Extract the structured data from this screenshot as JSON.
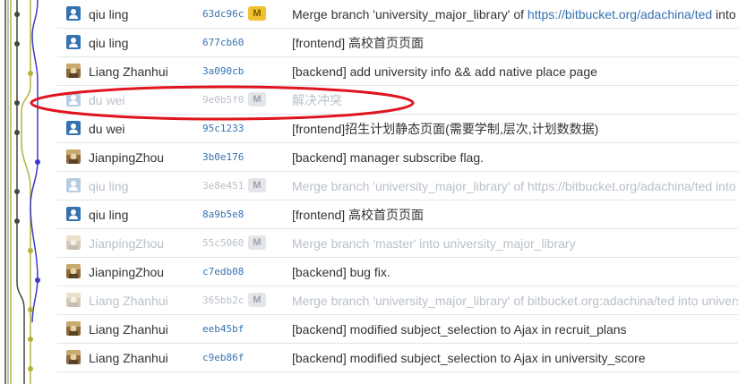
{
  "commits": [
    {
      "author": "qiu ling",
      "avatar": "blue-user-icon",
      "hash": "63dc96c",
      "merge": true,
      "merge_label": "M",
      "message": "Merge branch 'university_major_library' of ",
      "link": "https://bitbucket.org/adachina/ted",
      "message_tail": " into university_major_library",
      "faded": false
    },
    {
      "author": "qiu ling",
      "avatar": "blue-user-icon",
      "hash": "677cb60",
      "merge": false,
      "merge_label": "",
      "message": "[frontend] 高校首页页面",
      "link": "",
      "message_tail": "",
      "faded": false
    },
    {
      "author": "Liang Zhanhui",
      "avatar": "photo-avatar-icon",
      "hash": "3a090cb",
      "merge": false,
      "merge_label": "",
      "message": "[backend] add university info && add native place page",
      "link": "",
      "message_tail": "",
      "faded": false
    },
    {
      "author": "du wei",
      "avatar": "blue-user-icon",
      "hash": "9e0b5f0",
      "merge": true,
      "merge_label": "M",
      "message": "解决冲突",
      "link": "",
      "message_tail": "",
      "faded": true
    },
    {
      "author": "du wei",
      "avatar": "blue-user-icon",
      "hash": "95c1233",
      "merge": false,
      "merge_label": "",
      "message": "[frontend]招生计划静态页面(需要学制,层次,计划数数据)",
      "link": "",
      "message_tail": "",
      "faded": false
    },
    {
      "author": "JianpingZhou",
      "avatar": "photo-avatar-icon",
      "hash": "3b0e176",
      "merge": false,
      "merge_label": "",
      "message": "[backend] manager subscribe flag.",
      "link": "",
      "message_tail": "",
      "faded": false
    },
    {
      "author": "qiu ling",
      "avatar": "blue-user-icon",
      "hash": "3e8e451",
      "merge": true,
      "merge_label": "M",
      "message": "Merge branch 'university_major_library' of ",
      "link": "https://bitbucket.org/adachina/ted",
      "message_tail": " into university_major_library",
      "faded": true
    },
    {
      "author": "qiu ling",
      "avatar": "blue-user-icon",
      "hash": "8a9b5e8",
      "merge": false,
      "merge_label": "",
      "message": "[frontend] 高校首页页面",
      "link": "",
      "message_tail": "",
      "faded": false
    },
    {
      "author": "JianpingZhou",
      "avatar": "photo-avatar-icon",
      "hash": "55c5060",
      "merge": true,
      "merge_label": "M",
      "message": "Merge branch 'master' into university_major_library",
      "link": "",
      "message_tail": "",
      "faded": true
    },
    {
      "author": "JianpingZhou",
      "avatar": "photo-avatar-icon",
      "hash": "c7edb08",
      "merge": false,
      "merge_label": "",
      "message": "[backend] bug fix.",
      "link": "",
      "message_tail": "",
      "faded": false
    },
    {
      "author": "Liang Zhanhui",
      "avatar": "photo-avatar-icon",
      "hash": "365bb2c",
      "merge": true,
      "merge_label": "M",
      "message": "Merge branch 'university_major_library' of bitbucket.org:adachina/ted into university_major_library",
      "link": "",
      "message_tail": "",
      "faded": true
    },
    {
      "author": "Liang Zhanhui",
      "avatar": "photo-avatar-icon",
      "hash": "eeb45bf",
      "merge": false,
      "merge_label": "",
      "message": "[backend] modified subject_selection to Ajax in recruit_plans",
      "link": "",
      "message_tail": "",
      "faded": false
    },
    {
      "author": "Liang Zhanhui",
      "avatar": "photo-avatar-icon",
      "hash": "c9eb86f",
      "merge": false,
      "merge_label": "",
      "message": "[backend] modified subject_selection to Ajax in university_score",
      "link": "",
      "message_tail": "",
      "faded": false
    }
  ],
  "graph": {
    "colors": {
      "gray": "#444444",
      "olive": "#b3b33a",
      "blue": "#3b3bc8",
      "lightgray": "#aaaaaa"
    },
    "node_lanes": [
      "gray",
      "gray",
      "olive",
      "gray",
      "gray",
      "blue",
      "gray",
      "gray",
      "olive",
      "blue",
      "olive",
      "olive",
      "olive"
    ]
  },
  "annotation": {
    "color": "#e0141e",
    "shape": "ellipse"
  }
}
